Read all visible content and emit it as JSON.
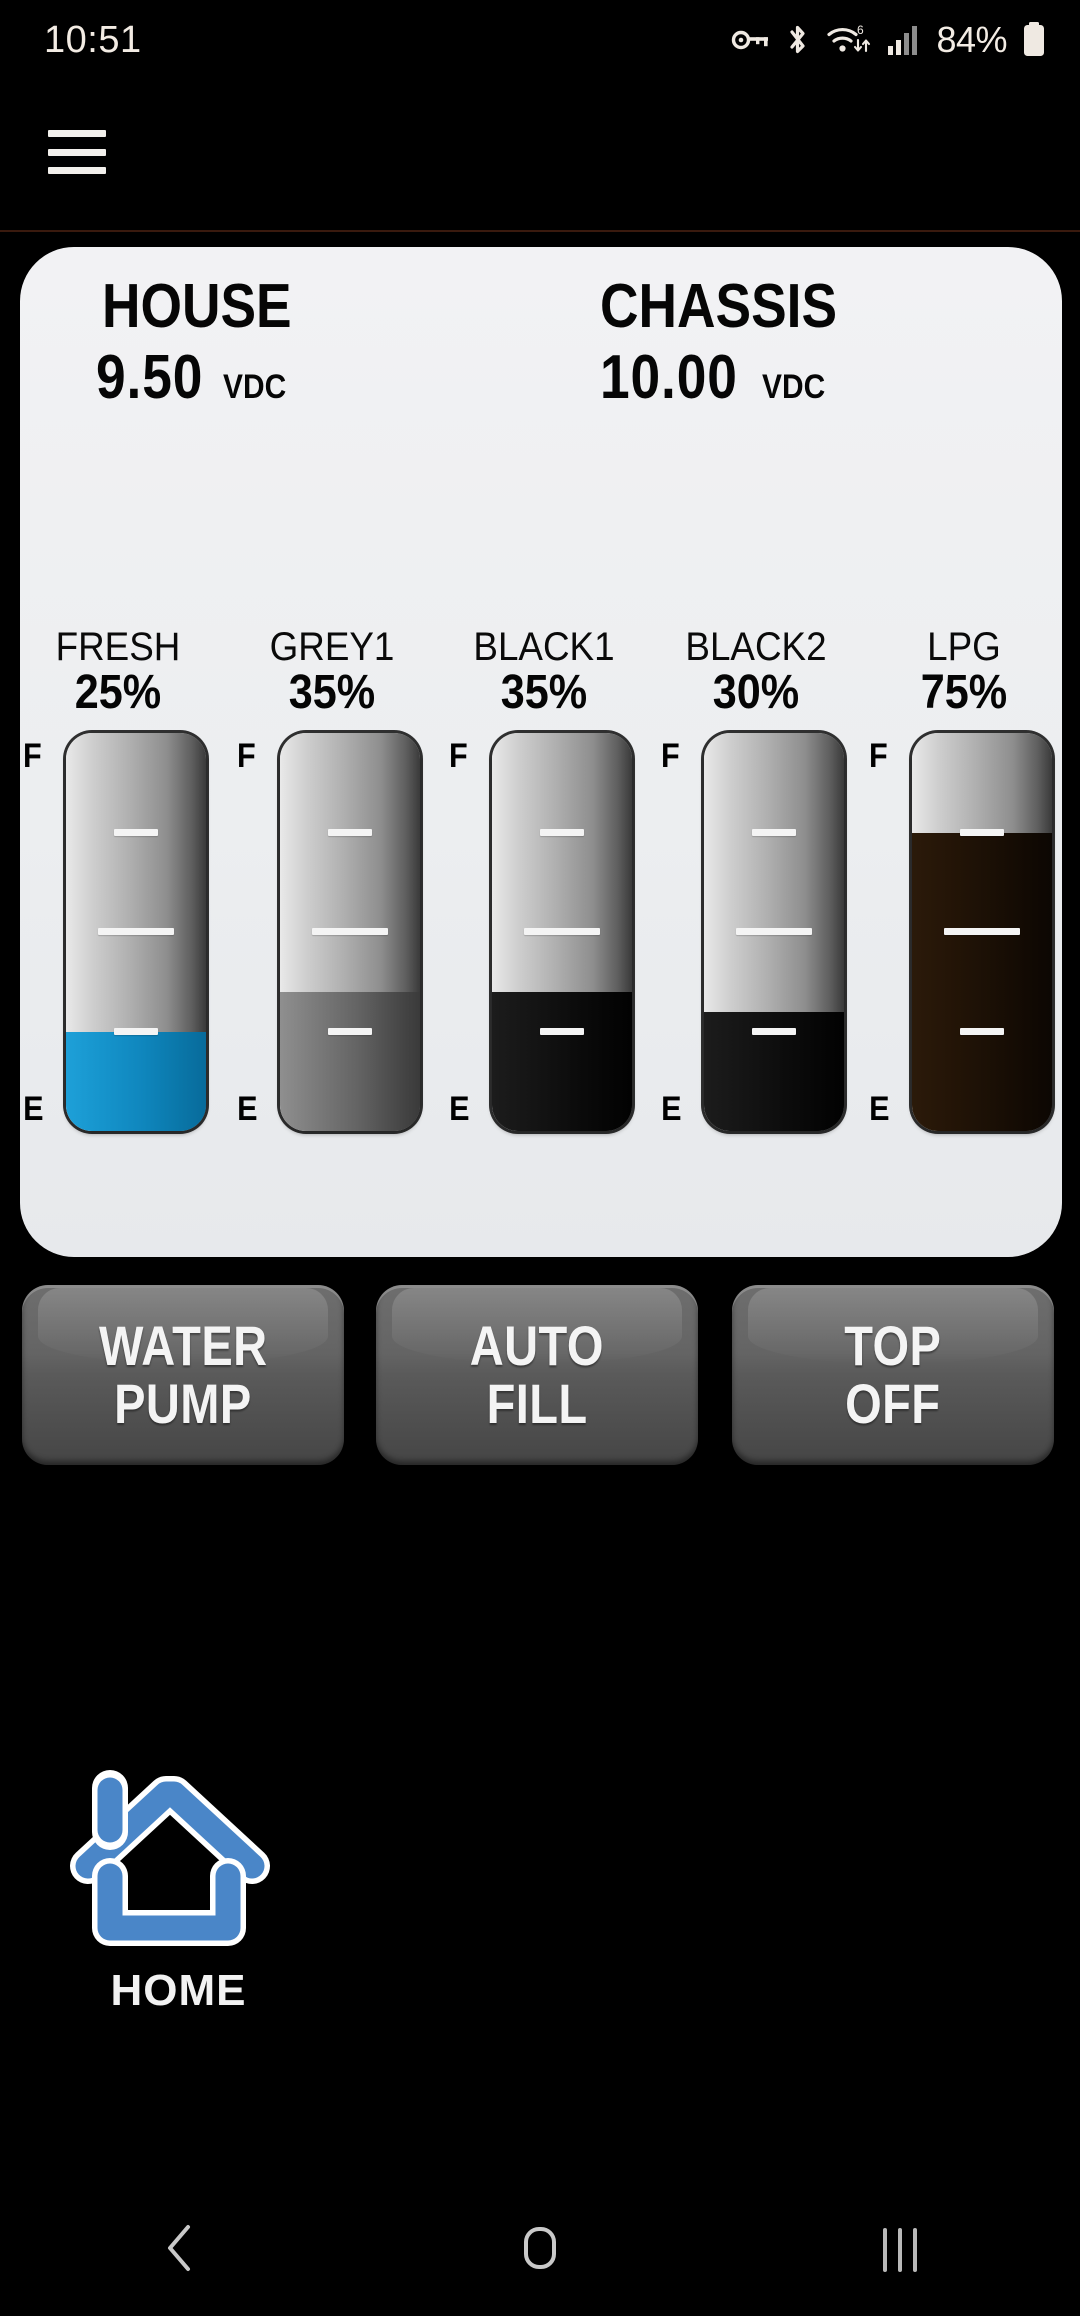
{
  "status_bar": {
    "time": "10:51",
    "battery_percent": "84%",
    "icons": [
      "vpn-key-icon",
      "bluetooth-icon",
      "wifi-6-icon",
      "cellular-signal-icon",
      "battery-icon"
    ]
  },
  "header": {
    "menu_icon": "hamburger-menu-icon"
  },
  "power": {
    "house": {
      "name": "HOUSE",
      "value": "9.50",
      "unit": "VDC"
    },
    "chassis": {
      "name": "CHASSIS",
      "value": "10.00",
      "unit": "VDC"
    }
  },
  "gauge_scale": {
    "full": "F",
    "empty": "E"
  },
  "tanks": [
    {
      "label": "FRESH",
      "percent_text": "25%",
      "percent": 25,
      "fill_type": "fresh-water",
      "color": "#0e86bd"
    },
    {
      "label": "GREY1",
      "percent_text": "35%",
      "percent": 35,
      "fill_type": "grey-water",
      "color": "#6a6a6a"
    },
    {
      "label": "BLACK1",
      "percent_text": "35%",
      "percent": 35,
      "fill_type": "black-water",
      "color": "#0a0a0a"
    },
    {
      "label": "BLACK2",
      "percent_text": "30%",
      "percent": 30,
      "fill_type": "black-water",
      "color": "#0a0a0a"
    },
    {
      "label": "LPG",
      "percent_text": "75%",
      "percent": 75,
      "fill_type": "propane",
      "color": "#241507"
    }
  ],
  "heaters": [
    {
      "name": "tank-heater-grey1",
      "icon": "tank-heater-icon",
      "active": false
    },
    {
      "name": "tank-heater-black2",
      "icon": "tank-heater-icon",
      "active": false
    }
  ],
  "buttons": [
    {
      "line1": "WATER",
      "line2": "PUMP"
    },
    {
      "line1": "AUTO",
      "line2": "FILL"
    },
    {
      "line1": "TOP",
      "line2": "OFF"
    }
  ],
  "home": {
    "label": "HOME",
    "icon": "house-icon",
    "color": "#4a86c8"
  },
  "nav_bar": {
    "back": "back-icon",
    "home": "home-icon",
    "recents": "recents-icon"
  }
}
